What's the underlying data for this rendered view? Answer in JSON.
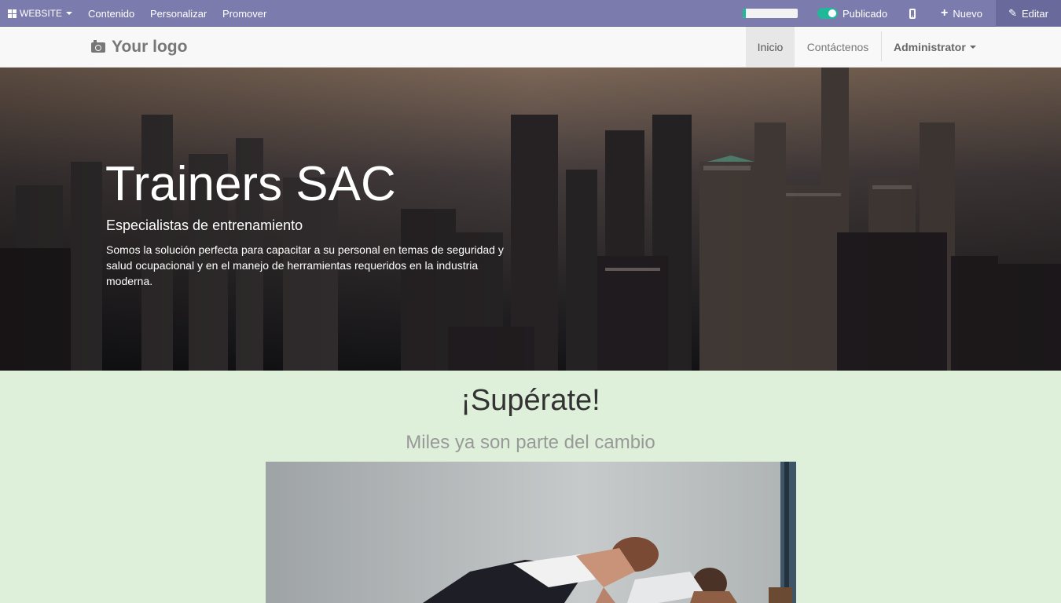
{
  "adminbar": {
    "website_label": "WEBSITE",
    "menu": [
      "Contenido",
      "Personalizar",
      "Promover"
    ],
    "progress": 0.05,
    "published_label": "Publicado",
    "new_label": "Nuevo",
    "edit_label": "Editar",
    "accent_color": "#7c7bad"
  },
  "navbar": {
    "logo_text": "Your logo",
    "items": [
      "Inicio",
      "Contáctenos"
    ],
    "admin_label": "Administrator"
  },
  "hero": {
    "title": "Trainers SAC",
    "subtitle": "Especialistas de entrenamiento",
    "text": "Somos la solución perfecta para capacitar a su personal en temas de seguridad y salud ocupacional y en el manejo de herramientas requeridos en la industria moderna."
  },
  "section": {
    "title": "¡Supérate!",
    "subtitle": "Miles ya son parte del cambio",
    "background": "#dff0da"
  }
}
